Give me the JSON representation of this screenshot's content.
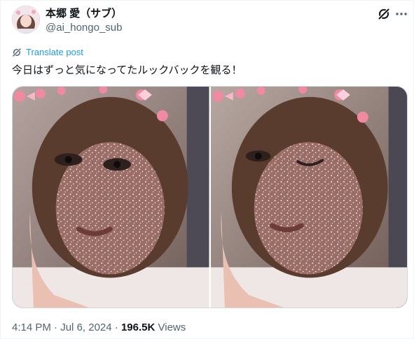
{
  "author": {
    "display_name": "本郷 愛（サブ）",
    "handle": "@ai_hongo_sub",
    "avatar_icon": "profile-photo"
  },
  "header_actions": {
    "grok_icon": "grok-icon",
    "more_icon": "more-dots-icon"
  },
  "translate": {
    "label": "Translate post",
    "icon": "translate-icon"
  },
  "post": {
    "text": "今日はずっと気になってたルックバックを観る！"
  },
  "media": {
    "photo_count": 2,
    "photos": [
      {
        "subject": "selfie-eyes-open"
      },
      {
        "subject": "selfie-winking"
      }
    ]
  },
  "footer": {
    "time": "4:14 PM",
    "separator": "·",
    "date": "Jul 6, 2024",
    "views_count": "196.5K",
    "views_label": "Views"
  },
  "colors": {
    "text_primary": "#0f1419",
    "text_secondary": "#536471",
    "link": "#1d9bf0",
    "border": "#cfd9de"
  }
}
